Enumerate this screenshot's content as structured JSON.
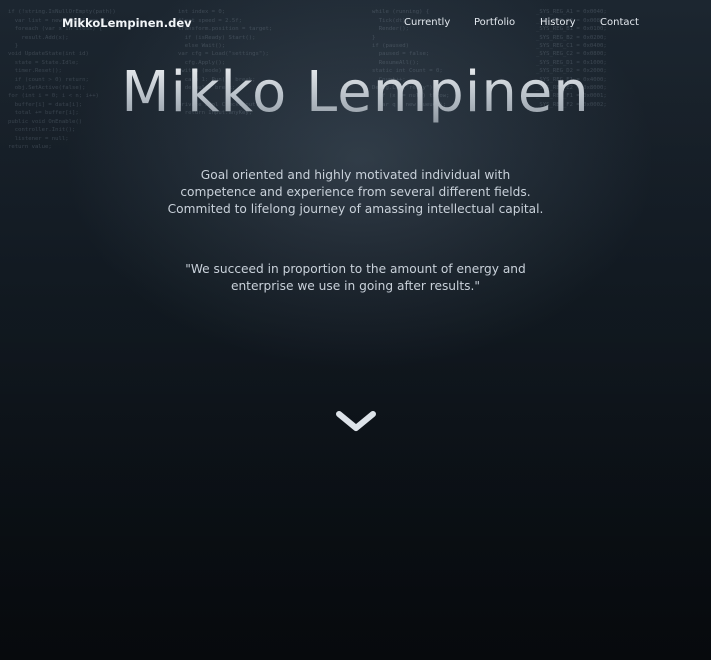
{
  "nav": {
    "brand": "MikkoLempinen.dev",
    "links": [
      "Currently",
      "Portfolio",
      "History",
      "Contact"
    ]
  },
  "hero": {
    "title": "Mikko Lempinen",
    "intro_lines": [
      "Goal oriented and highly motivated individual with",
      "competence and experience from several different fields.",
      "Commited to lifelong journey of amassing intellectual capital."
    ],
    "quote_lines": [
      "\"We succeed in proportion to the amount of energy and",
      "enterprise we use in going after results.\""
    ],
    "scroll_icon": "chevron-down-icon"
  },
  "colors": {
    "background_dark": "#0c1218",
    "background_mid": "#1c2630",
    "text": "#c9d1da",
    "title_top": "#f2f4f6"
  }
}
